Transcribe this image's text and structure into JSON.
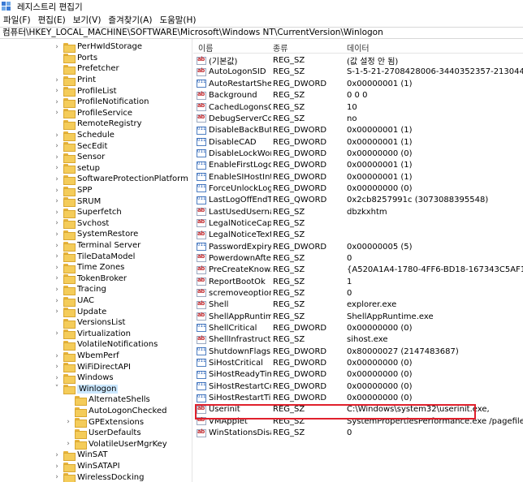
{
  "window": {
    "title": "레지스트리 편집기"
  },
  "menu": [
    "파일(F)",
    "편집(E)",
    "보기(V)",
    "즐겨찾기(A)",
    "도움말(H)"
  ],
  "address": "컴퓨터\\HKEY_LOCAL_MACHINE\\SOFTWARE\\Microsoft\\Windows NT\\CurrentVersion\\Winlogon",
  "tree": [
    {
      "label": "PerHwIdStorage",
      "expand": true
    },
    {
      "label": "Ports",
      "expand": false
    },
    {
      "label": "Prefetcher",
      "expand": false
    },
    {
      "label": "Print",
      "expand": true
    },
    {
      "label": "ProfileList",
      "expand": true
    },
    {
      "label": "ProfileNotification",
      "expand": true
    },
    {
      "label": "ProfileService",
      "expand": true
    },
    {
      "label": "RemoteRegistry",
      "expand": false
    },
    {
      "label": "Schedule",
      "expand": true
    },
    {
      "label": "SecEdit",
      "expand": true
    },
    {
      "label": "Sensor",
      "expand": true
    },
    {
      "label": "setup",
      "expand": true
    },
    {
      "label": "SoftwareProtectionPlatform",
      "expand": true
    },
    {
      "label": "SPP",
      "expand": true
    },
    {
      "label": "SRUM",
      "expand": true
    },
    {
      "label": "Superfetch",
      "expand": true
    },
    {
      "label": "Svchost",
      "expand": true
    },
    {
      "label": "SystemRestore",
      "expand": true
    },
    {
      "label": "Terminal Server",
      "expand": true
    },
    {
      "label": "TileDataModel",
      "expand": true
    },
    {
      "label": "Time Zones",
      "expand": true
    },
    {
      "label": "TokenBroker",
      "expand": true
    },
    {
      "label": "Tracing",
      "expand": true
    },
    {
      "label": "UAC",
      "expand": true
    },
    {
      "label": "Update",
      "expand": true
    },
    {
      "label": "VersionsList",
      "expand": false
    },
    {
      "label": "Virtualization",
      "expand": true
    },
    {
      "label": "VolatileNotifications",
      "expand": false
    },
    {
      "label": "WbemPerf",
      "expand": true
    },
    {
      "label": "WiFiDirectAPI",
      "expand": true
    },
    {
      "label": "Windows",
      "expand": true
    },
    {
      "label": "Winlogon",
      "expand": "open",
      "selected": true
    },
    {
      "label": "AlternateShells",
      "expand": false,
      "child": true
    },
    {
      "label": "AutoLogonChecked",
      "expand": false,
      "child": true
    },
    {
      "label": "GPExtensions",
      "expand": true,
      "child": true
    },
    {
      "label": "UserDefaults",
      "expand": false,
      "child": true
    },
    {
      "label": "VolatileUserMgrKey",
      "expand": true,
      "child": true
    },
    {
      "label": "WinSAT",
      "expand": true
    },
    {
      "label": "WinSATAPI",
      "expand": true
    },
    {
      "label": "WirelessDocking",
      "expand": true
    }
  ],
  "columns": {
    "name": "이름",
    "type": "종류",
    "data": "데이터"
  },
  "values": [
    {
      "name": "(기본값)",
      "type": "REG_SZ",
      "data": "(값 설정 안 됨)",
      "icon": "sz"
    },
    {
      "name": "AutoLogonSID",
      "type": "REG_SZ",
      "data": "S-1-5-21-2708428006-3440352357-21304489...",
      "icon": "sz"
    },
    {
      "name": "AutoRestartShell",
      "type": "REG_DWORD",
      "data": "0x00000001 (1)",
      "icon": "bin"
    },
    {
      "name": "Background",
      "type": "REG_SZ",
      "data": "0 0 0",
      "icon": "sz"
    },
    {
      "name": "CachedLogonsC...",
      "type": "REG_SZ",
      "data": "10",
      "icon": "sz"
    },
    {
      "name": "DebugServerCo...",
      "type": "REG_SZ",
      "data": "no",
      "icon": "sz"
    },
    {
      "name": "DisableBackButt...",
      "type": "REG_DWORD",
      "data": "0x00000001 (1)",
      "icon": "bin"
    },
    {
      "name": "DisableCAD",
      "type": "REG_DWORD",
      "data": "0x00000001 (1)",
      "icon": "bin"
    },
    {
      "name": "DisableLockWor...",
      "type": "REG_DWORD",
      "data": "0x00000000 (0)",
      "icon": "bin"
    },
    {
      "name": "EnableFirstLogo...",
      "type": "REG_DWORD",
      "data": "0x00000001 (1)",
      "icon": "bin"
    },
    {
      "name": "EnableSIHostInt...",
      "type": "REG_DWORD",
      "data": "0x00000001 (1)",
      "icon": "bin"
    },
    {
      "name": "ForceUnlockLog...",
      "type": "REG_DWORD",
      "data": "0x00000000 (0)",
      "icon": "bin"
    },
    {
      "name": "LastLogOffEndTi...",
      "type": "REG_QWORD",
      "data": "0x2cb8257991c (3073088395548)",
      "icon": "bin"
    },
    {
      "name": "LastUsedUserna...",
      "type": "REG_SZ",
      "data": "dbzkxhtm",
      "icon": "sz"
    },
    {
      "name": "LegalNoticeCap...",
      "type": "REG_SZ",
      "data": "",
      "icon": "sz"
    },
    {
      "name": "LegalNoticeText",
      "type": "REG_SZ",
      "data": "",
      "icon": "sz"
    },
    {
      "name": "PasswordExpiry...",
      "type": "REG_DWORD",
      "data": "0x00000005 (5)",
      "icon": "bin"
    },
    {
      "name": "PowerdownAfte...",
      "type": "REG_SZ",
      "data": "0",
      "icon": "sz"
    },
    {
      "name": "PreCreateKnow...",
      "type": "REG_SZ",
      "data": "{A520A1A4-1780-4FF6-BD18-167343C5AF16}",
      "icon": "sz"
    },
    {
      "name": "ReportBootOk",
      "type": "REG_SZ",
      "data": "1",
      "icon": "sz"
    },
    {
      "name": "scremoveoption",
      "type": "REG_SZ",
      "data": "0",
      "icon": "sz"
    },
    {
      "name": "Shell",
      "type": "REG_SZ",
      "data": "explorer.exe",
      "icon": "sz"
    },
    {
      "name": "ShellAppRuntime",
      "type": "REG_SZ",
      "data": "ShellAppRuntime.exe",
      "icon": "sz"
    },
    {
      "name": "ShellCritical",
      "type": "REG_DWORD",
      "data": "0x00000000 (0)",
      "icon": "bin"
    },
    {
      "name": "ShellInfrastructu...",
      "type": "REG_SZ",
      "data": "sihost.exe",
      "icon": "sz"
    },
    {
      "name": "ShutdownFlags",
      "type": "REG_DWORD",
      "data": "0x80000027 (2147483687)",
      "icon": "bin"
    },
    {
      "name": "SiHostCritical",
      "type": "REG_DWORD",
      "data": "0x00000000 (0)",
      "icon": "bin"
    },
    {
      "name": "SiHostReadyTim...",
      "type": "REG_DWORD",
      "data": "0x00000000 (0)",
      "icon": "bin"
    },
    {
      "name": "SiHostRestartCo...",
      "type": "REG_DWORD",
      "data": "0x00000000 (0)",
      "icon": "bin"
    },
    {
      "name": "SiHostRestartTi...",
      "type": "REG_DWORD",
      "data": "0x00000000 (0)",
      "icon": "bin"
    },
    {
      "name": "Userinit",
      "type": "REG_SZ",
      "data": "C:\\Windows\\system32\\userinit.exe,",
      "icon": "sz"
    },
    {
      "name": "VMApplet",
      "type": "REG_SZ",
      "data": "SystemPropertiesPerformance.exe /pagefile",
      "icon": "sz"
    },
    {
      "name": "WinStationsDisa...",
      "type": "REG_SZ",
      "data": "0",
      "icon": "sz"
    }
  ],
  "colors": {
    "highlight_box": "#e0202c",
    "selection": "#cce8ff",
    "folder": "#f4cc5a"
  }
}
